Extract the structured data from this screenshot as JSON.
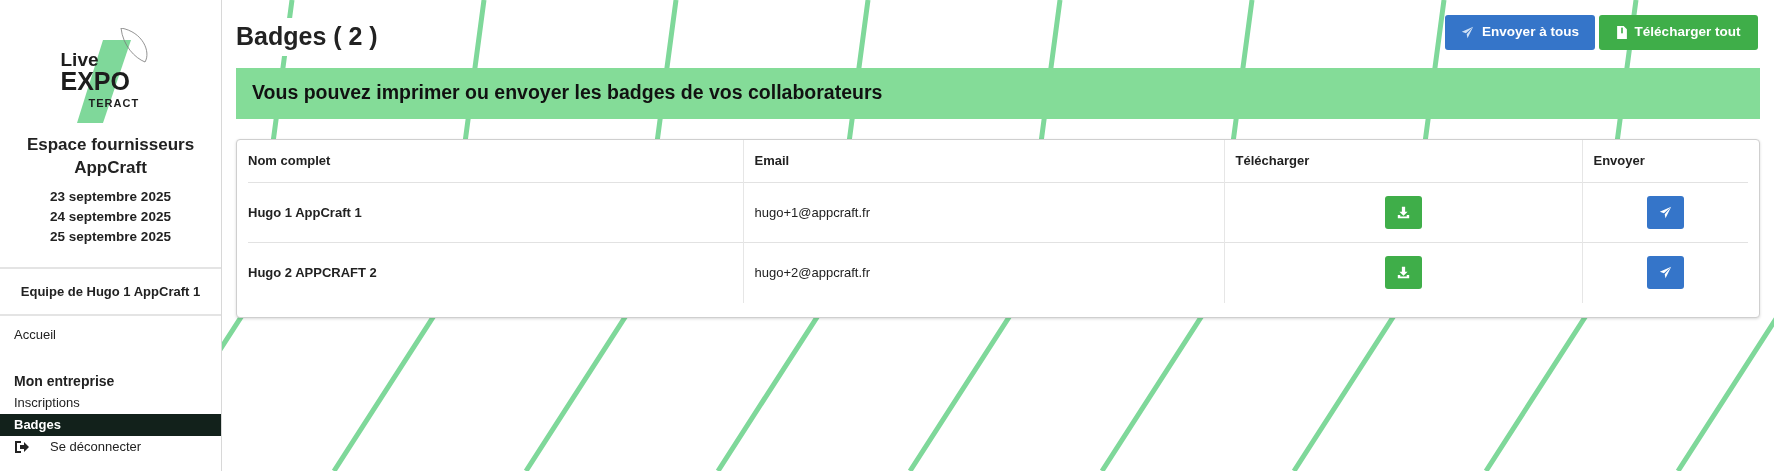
{
  "sidebar": {
    "logo": {
      "lines": [
        "Live",
        "EXPO",
        "TERACT"
      ]
    },
    "title": "Espace fournisseurs AppCraft",
    "dates": [
      "23 septembre 2025",
      "24 septembre 2025",
      "25 septembre 2025"
    ],
    "team": "Equipe de Hugo 1 AppCraft 1",
    "items": [
      {
        "kind": "link",
        "label": "Accueil",
        "selected": false
      },
      {
        "kind": "header",
        "label": "Mon entreprise"
      },
      {
        "kind": "link",
        "label": "Inscriptions",
        "selected": false
      },
      {
        "kind": "link",
        "label": "Badges",
        "selected": true
      },
      {
        "kind": "logout",
        "label": "Se déconnecter",
        "selected": false
      }
    ]
  },
  "page": {
    "title": "Badges ( 2 )",
    "actions": [
      {
        "kind": "send",
        "label": "Envoyer à tous"
      },
      {
        "kind": "download",
        "label": "Télécharger tout"
      }
    ],
    "banner": "Vous pouvez imprimer ou envoyer les badges de vos collaborateurs"
  },
  "table": {
    "columns": [
      "Nom complet",
      "Email",
      "Télécharger",
      "Envoyer"
    ],
    "rows": [
      {
        "name": "Hugo 1 AppCraft 1",
        "email": "hugo+1@appcraft.fr"
      },
      {
        "name": "Hugo 2 APPCRAFT 2",
        "email": "hugo+2@appcraft.fr"
      }
    ]
  }
}
